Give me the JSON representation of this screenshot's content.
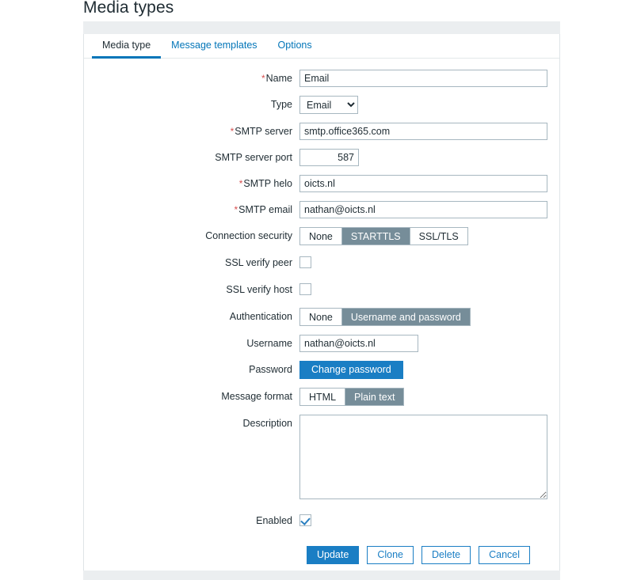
{
  "page": {
    "title": "Media types"
  },
  "tabs": [
    {
      "label": "Media type",
      "active": true
    },
    {
      "label": "Message templates",
      "active": false
    },
    {
      "label": "Options",
      "active": false
    }
  ],
  "form": {
    "name": {
      "label": "Name",
      "required": true,
      "value": "Email"
    },
    "type": {
      "label": "Type",
      "required": false,
      "value": "Email",
      "options": [
        "Email"
      ]
    },
    "smtp_server": {
      "label": "SMTP server",
      "required": true,
      "value": "smtp.office365.com"
    },
    "smtp_port": {
      "label": "SMTP server port",
      "required": false,
      "value": "587"
    },
    "smtp_helo": {
      "label": "SMTP helo",
      "required": true,
      "value": "oicts.nl"
    },
    "smtp_email": {
      "label": "SMTP email",
      "required": true,
      "value": "nathan@oicts.nl"
    },
    "connection_security": {
      "label": "Connection security",
      "options": [
        "None",
        "STARTTLS",
        "SSL/TLS"
      ],
      "selected": "STARTTLS"
    },
    "ssl_verify_peer": {
      "label": "SSL verify peer",
      "checked": false
    },
    "ssl_verify_host": {
      "label": "SSL verify host",
      "checked": false
    },
    "authentication": {
      "label": "Authentication",
      "options": [
        "None",
        "Username and password"
      ],
      "selected": "Username and password"
    },
    "username": {
      "label": "Username",
      "value": "nathan@oicts.nl"
    },
    "password": {
      "label": "Password",
      "button_label": "Change password"
    },
    "message_format": {
      "label": "Message format",
      "options": [
        "HTML",
        "Plain text"
      ],
      "selected": "Plain text"
    },
    "description": {
      "label": "Description",
      "value": ""
    },
    "enabled": {
      "label": "Enabled",
      "checked": true
    }
  },
  "actions": [
    {
      "label": "Update",
      "primary": true
    },
    {
      "label": "Clone",
      "primary": false
    },
    {
      "label": "Delete",
      "primary": false
    },
    {
      "label": "Cancel",
      "primary": false
    }
  ],
  "colors": {
    "accent_blue": "#1a7ec4",
    "link_blue": "#0275b8",
    "segment_selected": "#768d99",
    "required_red": "#d64e4e",
    "band_grey": "#ebeef0",
    "border_grey": "#a7b7c0"
  }
}
